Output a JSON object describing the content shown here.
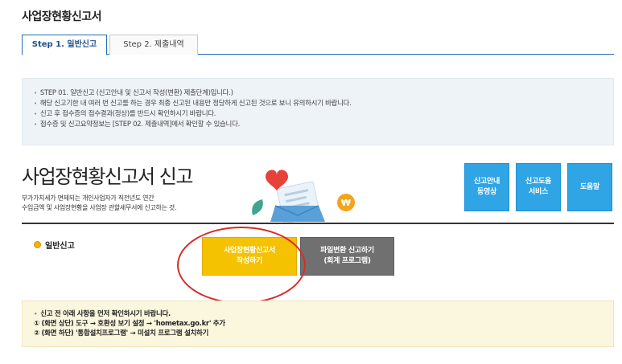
{
  "page": {
    "title": "사업장현황신고서"
  },
  "tabs": [
    {
      "label": "Step 1. 일반신고",
      "active": true
    },
    {
      "label": "Step 2. 제출내역",
      "active": false
    }
  ],
  "info": {
    "lines": [
      "STEP 01. 일반신고 (신고안내 및 신고서 작성(변환) 제출단계)입니다.)",
      "해당 신고기한 내 여러 번 신고를 하는 경우 최종 신고된 내용만 정당하게 신고된 것으로 보니 유의하시기 바랍니다.",
      "신고 후 접수증의 접수결과(정상)를 반드시 확인하시기 바랍니다.",
      "접수증 및 신고요약정보는 [STEP 02. 제출내역]에서 확인할 수 있습니다."
    ]
  },
  "main": {
    "title": "사업장현황신고서 신고",
    "desc_line1": "부가가치세가 면제되는 개인사업자가 직전년도 연간",
    "desc_line2": "수입금액 및 사업장현황을 사업장 관할세무서에 신고하는 것."
  },
  "side_buttons": [
    {
      "line1": "신고안내",
      "line2": "동영상"
    },
    {
      "line1": "신고도움",
      "line2": "서비스"
    },
    {
      "line1": "도움말",
      "line2": ""
    }
  ],
  "section": {
    "label": "일반신고"
  },
  "actions": {
    "write_line1": "사업장현황신고서",
    "write_line2": "작성하기",
    "convert_line1": "파일변환 신고하기",
    "convert_line2": "(회계 프로그램)"
  },
  "notice": {
    "head": "신고 전 아래 사항을 먼저 확인하시기 바랍니다.",
    "line1": "① (화면 상단) 도구 → 호환성 보기 설정 → 'hometax.go.kr' 추가",
    "line2": "② (화면 하단) '통합설치프로그램' → 미설치 프로그램 설치하기"
  },
  "colors": {
    "accent": "#1f6fb5",
    "side_button": "#2fa5e6",
    "primary_action": "#f4c200",
    "secondary_action": "#707070",
    "highlight_ellipse": "#d92b2b"
  },
  "icons": [
    "heart-icon",
    "document-icon",
    "leaf-icon",
    "money-badge-icon",
    "bullet-dot-icon"
  ]
}
